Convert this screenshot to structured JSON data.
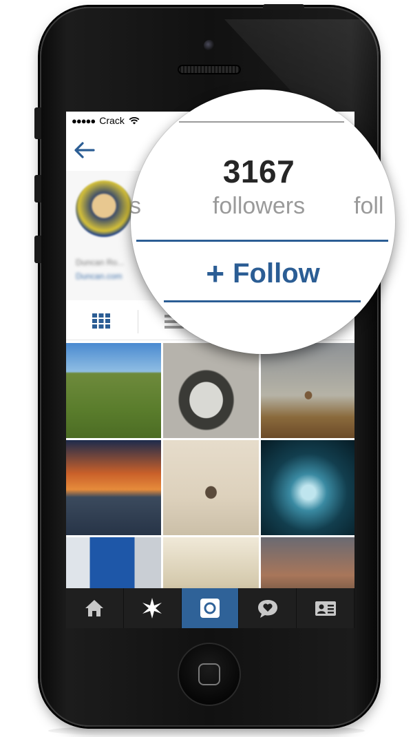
{
  "status_bar": {
    "signal": "●●●●●",
    "carrier": "Crack"
  },
  "nav": {
    "back_icon": "left-arrow-icon"
  },
  "profile": {
    "name_blurred": "Duncan Ro...",
    "link_blurred": "Duncan.com"
  },
  "stats": {
    "left_fragment": "s",
    "followers_count": "3167",
    "followers_label": "followers",
    "right_fragment": "foll"
  },
  "follow_button": {
    "plus": "+",
    "label": "Follow"
  },
  "view_toggle": {
    "grid_icon": "grid-icon",
    "list_icon": "list-icon"
  },
  "photos": [
    "pasture-sheep",
    "swans-ducks-snow",
    "baobab-tree",
    "pier-sunset",
    "bare-tree-sepia",
    "fish-school-vortex",
    "blue-sky-buildings",
    "dreamcatcher-sign",
    "market-buildings"
  ],
  "tab_bar": [
    {
      "name": "home",
      "icon": "home-icon"
    },
    {
      "name": "explore",
      "icon": "star-icon"
    },
    {
      "name": "camera",
      "icon": "camera-icon",
      "active": true
    },
    {
      "name": "news",
      "icon": "speech-heart-icon"
    },
    {
      "name": "profile",
      "icon": "profile-card-icon"
    }
  ],
  "colors": {
    "accent": "#2b5d94",
    "tab_active": "#2f6298",
    "tab_bar": "#1f1f1f"
  }
}
